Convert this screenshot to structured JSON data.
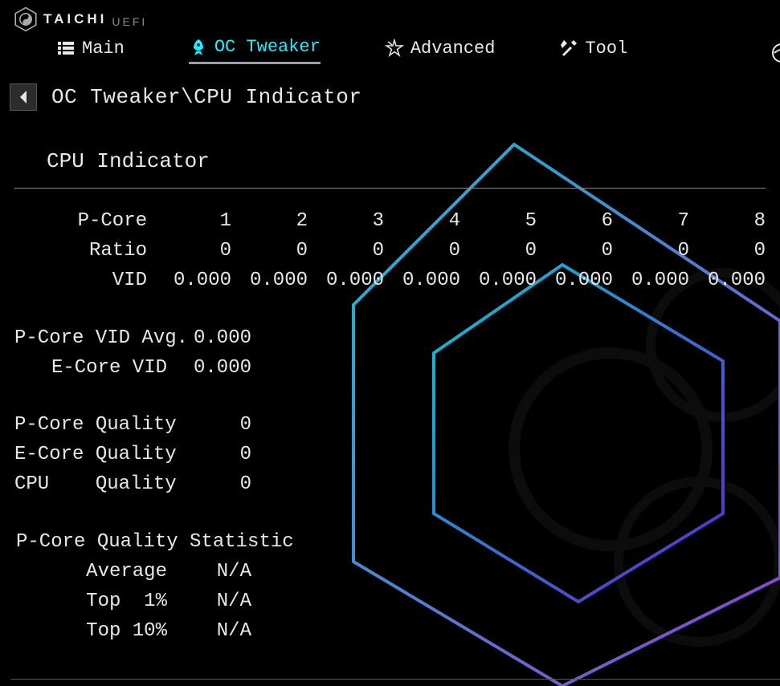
{
  "brand": {
    "name": "TAICHI",
    "sub": "UEFI"
  },
  "tabs": {
    "main": "Main",
    "oc_tweaker": "OC Tweaker",
    "advanced": "Advanced",
    "tool": "Tool"
  },
  "breadcrumb": "OC Tweaker\\CPU Indicator",
  "section_title": "CPU Indicator",
  "pcore_table": {
    "header_label": "P-Core",
    "headers": [
      "1",
      "2",
      "3",
      "4",
      "5",
      "6",
      "7",
      "8"
    ],
    "rows": [
      {
        "label": "Ratio",
        "values": [
          "0",
          "0",
          "0",
          "0",
          "0",
          "0",
          "0",
          "0"
        ]
      },
      {
        "label": "VID",
        "values": [
          "0.000",
          "0.000",
          "0.000",
          "0.000",
          "0.000",
          "0.000",
          "0.000",
          "0.000"
        ]
      }
    ]
  },
  "avg": {
    "pcore_vid_avg_label": "P-Core VID Avg.",
    "pcore_vid_avg_value": "0.000",
    "ecore_vid_label": "E-Core VID",
    "ecore_vid_value": "0.000"
  },
  "quality": {
    "pcore_label": "P-Core Quality",
    "pcore_value": "0",
    "ecore_label": "E-Core Quality",
    "ecore_value": "0",
    "cpu_label": "CPU    Quality",
    "cpu_value": "0"
  },
  "stat": {
    "heading": "P-Core Quality Statistic",
    "average_label": "Average",
    "average_value": "N/A",
    "top1_label": "Top  1%",
    "top1_value": "N/A",
    "top10_label": "Top 10%",
    "top10_value": "N/A"
  }
}
